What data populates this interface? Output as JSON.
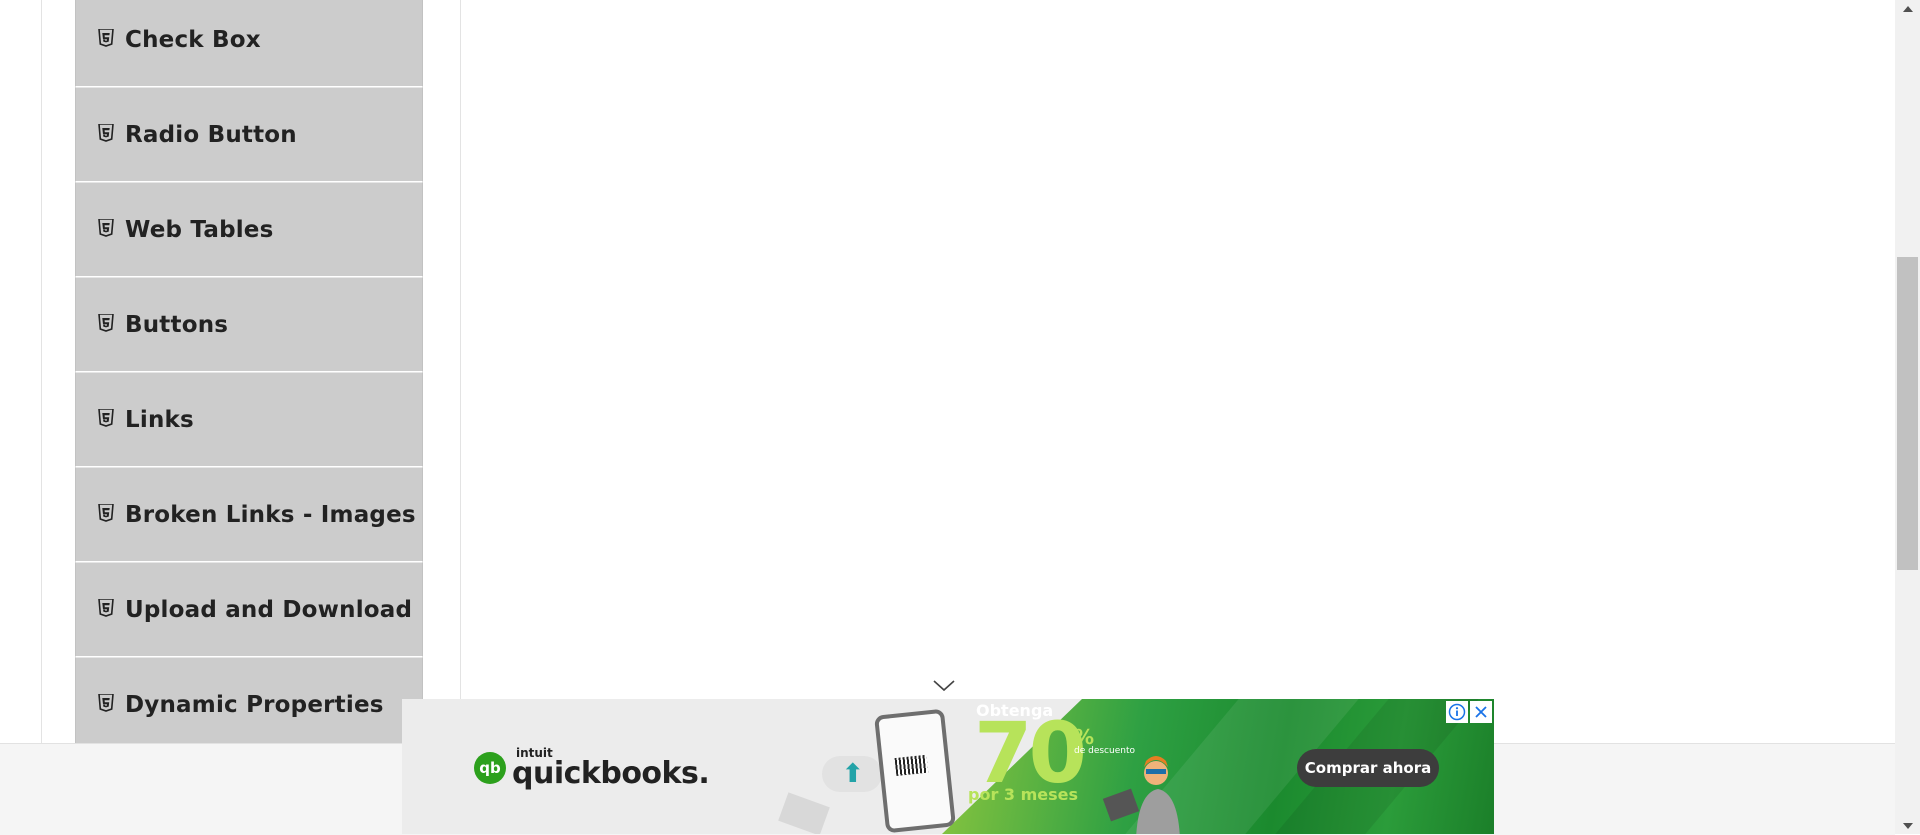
{
  "sidebar": {
    "items": [
      {
        "label": "Check Box"
      },
      {
        "label": "Radio Button"
      },
      {
        "label": "Web Tables"
      },
      {
        "label": "Buttons"
      },
      {
        "label": "Links"
      },
      {
        "label": "Broken Links - Images"
      },
      {
        "label": "Upload and Download"
      },
      {
        "label": "Dynamic Properties"
      }
    ],
    "item_icon": "html5-icon",
    "item_bg": "#cccccc"
  },
  "ad": {
    "brand_small": "intuit",
    "brand": "quickbooks.",
    "logo_mark": "qb",
    "obtenga": "Obtenga",
    "number": "70",
    "percent": "%",
    "de_descuento": "de descuento",
    "duration": "por 3 meses",
    "cta": "Comprar ahora",
    "accent": "#2ca01c"
  }
}
